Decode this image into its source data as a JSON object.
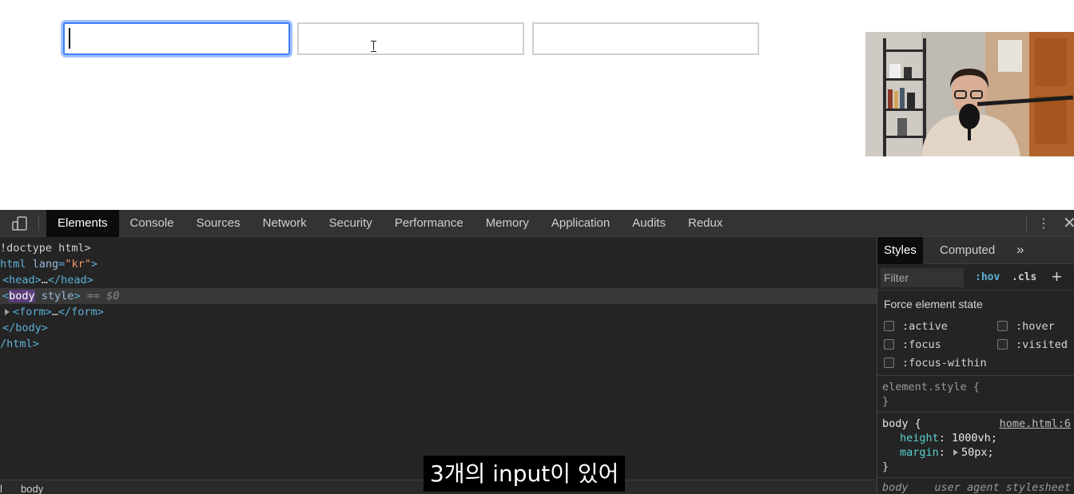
{
  "page": {
    "inputs": [
      {
        "name": "input-1",
        "value": "",
        "focused": true
      },
      {
        "name": "input-2",
        "value": ""
      },
      {
        "name": "input-3",
        "value": ""
      }
    ]
  },
  "devtools": {
    "tabs": [
      "Elements",
      "Console",
      "Sources",
      "Network",
      "Security",
      "Performance",
      "Memory",
      "Application",
      "Audits",
      "Redux"
    ],
    "active_tab": "Elements",
    "tree": {
      "doctype": "!doctype html>",
      "html_open_tag": "html",
      "html_attr_name": "lang",
      "html_attr_val": "\"kr\"",
      "head": "<head>",
      "head_close": "</head>",
      "body_tag": "body",
      "body_attr": "style",
      "body_eq": "== $0",
      "form": "<form>",
      "form_close": "</form>",
      "body_close": "</body>",
      "html_close": "/html>",
      "ellipsis": "…"
    },
    "breadcrumb": [
      "l",
      "body"
    ],
    "styles": {
      "tabs": [
        "Styles",
        "Computed"
      ],
      "more": "»",
      "filter_placeholder": "Filter",
      "hov": ":hov",
      "cls": ".cls",
      "plus": "+",
      "force_title": "Force element state",
      "states": [
        ":active",
        ":hover",
        ":focus",
        ":visited",
        ":focus-within"
      ],
      "element_style_selector": "element.style {",
      "close_brace": "}",
      "body_selector": "body",
      "open_brace": "{",
      "body_source": "home.html:6",
      "declarations": [
        {
          "prop": "height",
          "value": "1000vh;"
        },
        {
          "prop": "margin",
          "value": "50px;"
        }
      ],
      "ua_selector": "body",
      "ua_label": "user agent stylesheet"
    }
  },
  "subtitle": "3개의 input이 있어",
  "colors": {
    "focus_ring": "#3b82f6",
    "devtools_bg": "#242424",
    "tag_blue": "#5db0d7",
    "attr_orange": "#f29766"
  }
}
